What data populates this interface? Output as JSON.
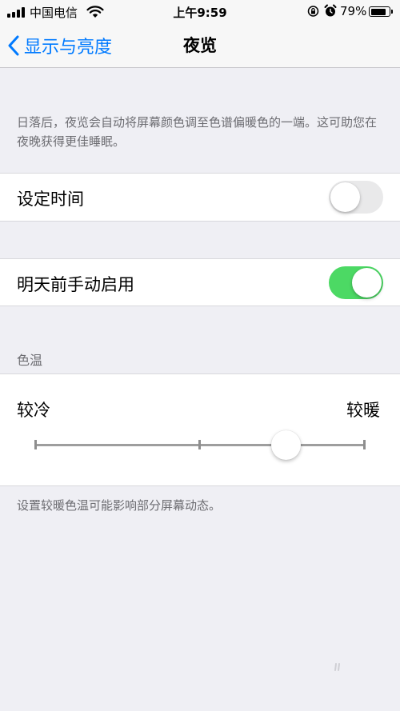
{
  "status_bar": {
    "carrier": "中国电信",
    "time": "上午9:59",
    "battery_percent": "79%",
    "battery_level": 0.79,
    "icons": [
      "signal-icon",
      "wifi-icon",
      "orientation-lock-icon",
      "alarm-icon",
      "battery-icon"
    ]
  },
  "nav": {
    "back_label": "显示与亮度",
    "title": "夜览"
  },
  "description": "日落后，夜览会自动将屏幕颜色调至色谱偏暖色的一端。这可助您在夜晚获得更佳睡眠。",
  "scheduled": {
    "label": "设定时间",
    "enabled": false
  },
  "manual": {
    "label": "明天前手动启用",
    "enabled": true
  },
  "color_temperature": {
    "header": "色温",
    "min_label": "较冷",
    "max_label": "较暖",
    "value": 0.76,
    "footer": "设置较暖色温可能影响部分屏幕动态。"
  },
  "colors": {
    "accent": "#007aff",
    "switch_on": "#4cd964",
    "background": "#efeff4"
  }
}
